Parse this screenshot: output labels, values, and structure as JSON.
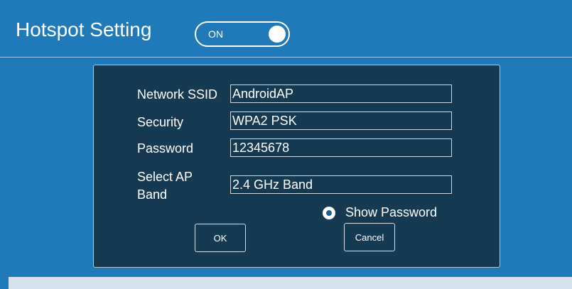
{
  "header": {
    "title": "Hotspot Setting",
    "toggle_label": "ON",
    "toggle_state": "on"
  },
  "form": {
    "ssid_label": "Network SSID",
    "ssid_value": "AndroidAP",
    "security_label": "Security",
    "security_value": "WPA2 PSK",
    "password_label": "Password",
    "password_value": "12345678",
    "band_label_line1": "Select AP",
    "band_label_line2": "Band",
    "band_value": "2.4 GHz Band",
    "show_password_label": "Show Password",
    "show_password_checked": true
  },
  "buttons": {
    "ok_label": "OK",
    "cancel_label": "Cancel"
  },
  "colors": {
    "background": "#2079b9",
    "dialog": "#163a52",
    "text": "#ffffff"
  }
}
